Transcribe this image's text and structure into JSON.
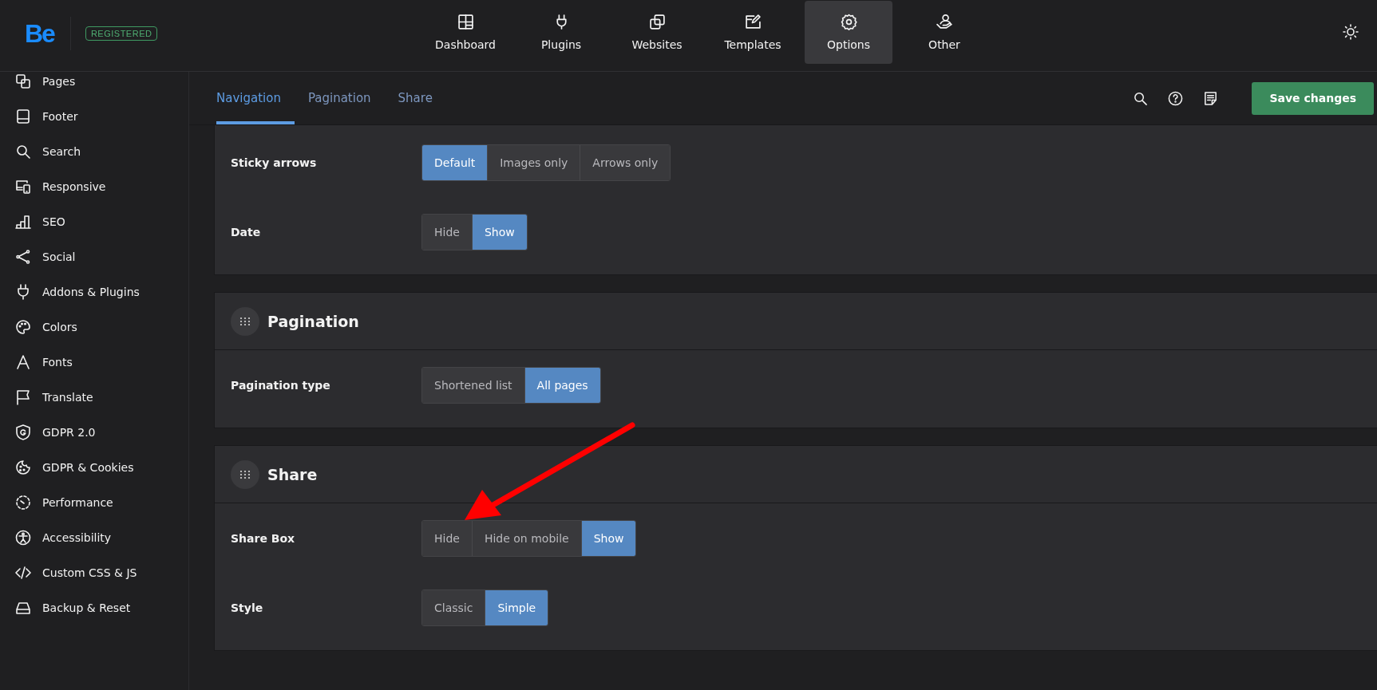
{
  "header": {
    "logo": "Be",
    "badge": "REGISTERED",
    "nav": [
      {
        "label": "Dashboard",
        "selected": false
      },
      {
        "label": "Plugins",
        "selected": false
      },
      {
        "label": "Websites",
        "selected": false
      },
      {
        "label": "Templates",
        "selected": false
      },
      {
        "label": "Options",
        "selected": true
      },
      {
        "label": "Other",
        "selected": false
      }
    ]
  },
  "sidebar": {
    "items": [
      {
        "label": "Pages"
      },
      {
        "label": "Footer"
      },
      {
        "label": "Search"
      },
      {
        "label": "Responsive"
      },
      {
        "label": "SEO"
      },
      {
        "label": "Social"
      },
      {
        "label": "Addons & Plugins"
      },
      {
        "label": "Colors"
      },
      {
        "label": "Fonts"
      },
      {
        "label": "Translate"
      },
      {
        "label": "GDPR 2.0"
      },
      {
        "label": "GDPR & Cookies"
      },
      {
        "label": "Performance"
      },
      {
        "label": "Accessibility"
      },
      {
        "label": "Custom CSS & JS"
      },
      {
        "label": "Backup & Reset"
      }
    ]
  },
  "tabs": [
    {
      "label": "Navigation",
      "selected": true
    },
    {
      "label": "Pagination",
      "selected": false
    },
    {
      "label": "Share",
      "selected": false
    }
  ],
  "save_button": "Save changes",
  "sections": [
    {
      "rows": [
        {
          "label": "Sticky arrows",
          "options": [
            {
              "label": "Default",
              "selected": true
            },
            {
              "label": "Images only",
              "selected": false
            },
            {
              "label": "Arrows only",
              "selected": false
            }
          ]
        },
        {
          "label": "Date",
          "options": [
            {
              "label": "Hide",
              "selected": false
            },
            {
              "label": "Show",
              "selected": true
            }
          ]
        }
      ]
    },
    {
      "title": "Pagination",
      "rows": [
        {
          "label": "Pagination type",
          "options": [
            {
              "label": "Shortened list",
              "selected": false
            },
            {
              "label": "All pages",
              "selected": true
            }
          ]
        }
      ]
    },
    {
      "title": "Share",
      "rows": [
        {
          "label": "Share Box",
          "options": [
            {
              "label": "Hide",
              "selected": false
            },
            {
              "label": "Hide on mobile",
              "selected": false
            },
            {
              "label": "Show",
              "selected": true
            }
          ]
        },
        {
          "label": "Style",
          "options": [
            {
              "label": "Classic",
              "selected": false
            },
            {
              "label": "Simple",
              "selected": true
            }
          ]
        }
      ]
    }
  ],
  "annotations": [
    {
      "kind": "arrow"
    }
  ]
}
